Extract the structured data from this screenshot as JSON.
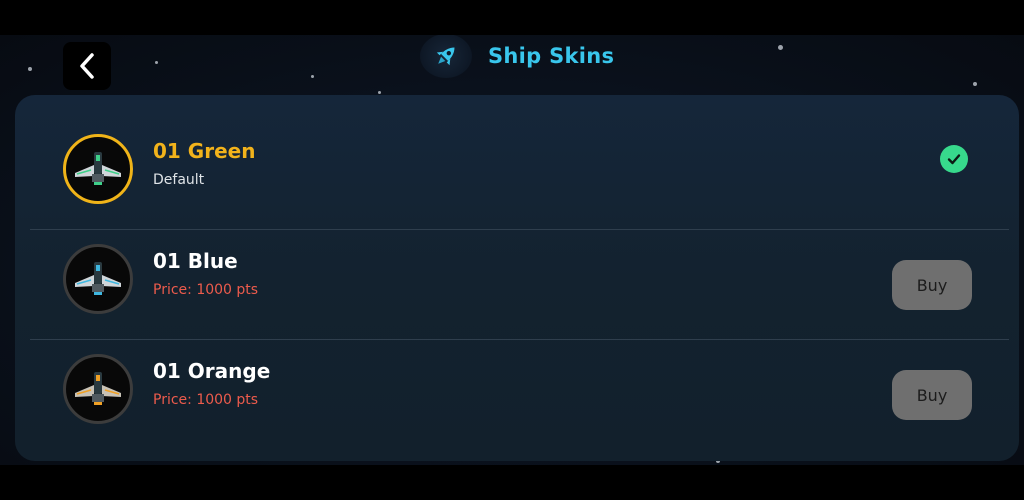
{
  "header": {
    "title": "Ship Skins",
    "back_icon": "chevron-left-icon",
    "title_icon": "rocket-icon",
    "accent_color": "#39c6ec"
  },
  "skins": [
    {
      "name": "01 Green",
      "subtitle": "Default",
      "status": "selected",
      "ship_color": "#3fd08a",
      "highlight_color": "#f2b31b"
    },
    {
      "name": "01 Blue",
      "subtitle": "Price: 1000 pts",
      "status": "buy",
      "button_label": "Buy",
      "ship_color": "#3fb7e0"
    },
    {
      "name": "01 Orange",
      "subtitle": "Price: 1000 pts",
      "status": "buy",
      "button_label": "Buy",
      "ship_color": "#f0a126"
    }
  ],
  "colors": {
    "price_text": "#ec5b4c",
    "check_badge": "#37d98c",
    "buy_button": "#6f6f6f"
  }
}
